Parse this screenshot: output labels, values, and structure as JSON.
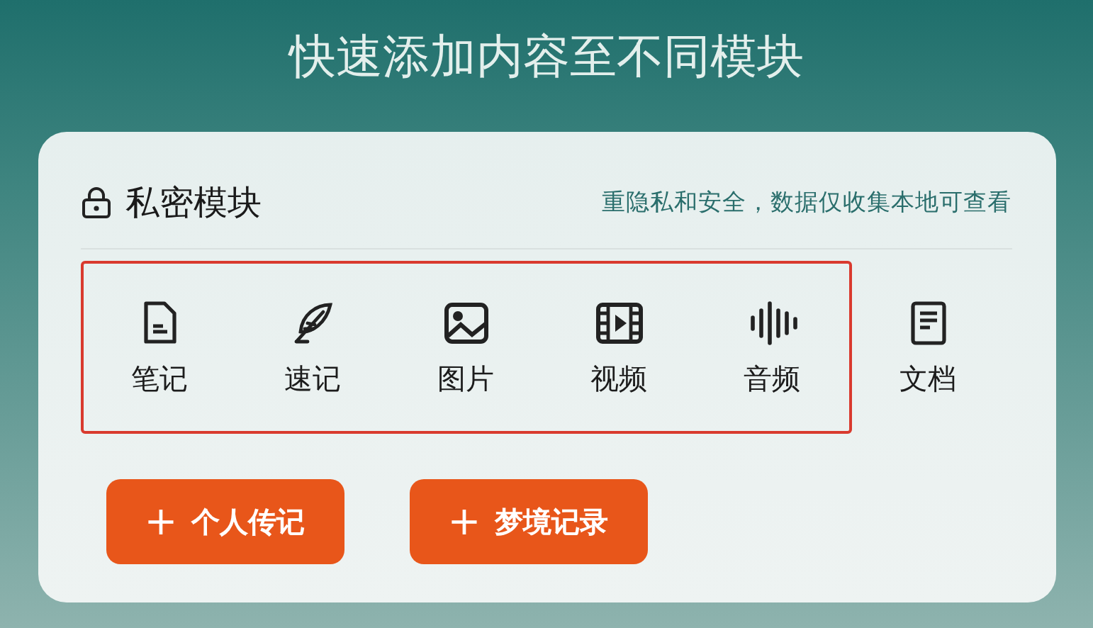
{
  "header": {
    "title": "快速添加内容至不同模块"
  },
  "card": {
    "title": "私密模块",
    "hint": "重隐私和安全，数据仅收集本地可查看",
    "items": [
      {
        "kind": "note",
        "label": "笔记",
        "highlighted": true
      },
      {
        "kind": "quill",
        "label": "速记",
        "highlighted": true
      },
      {
        "kind": "image",
        "label": "图片",
        "highlighted": true
      },
      {
        "kind": "video",
        "label": "视频",
        "highlighted": true
      },
      {
        "kind": "audio",
        "label": "音频",
        "highlighted": true
      },
      {
        "kind": "document",
        "label": "文档",
        "highlighted": false
      }
    ],
    "buttons": [
      {
        "icon": "+",
        "label": "个人传记"
      },
      {
        "icon": "+",
        "label": "梦境记录"
      }
    ]
  }
}
